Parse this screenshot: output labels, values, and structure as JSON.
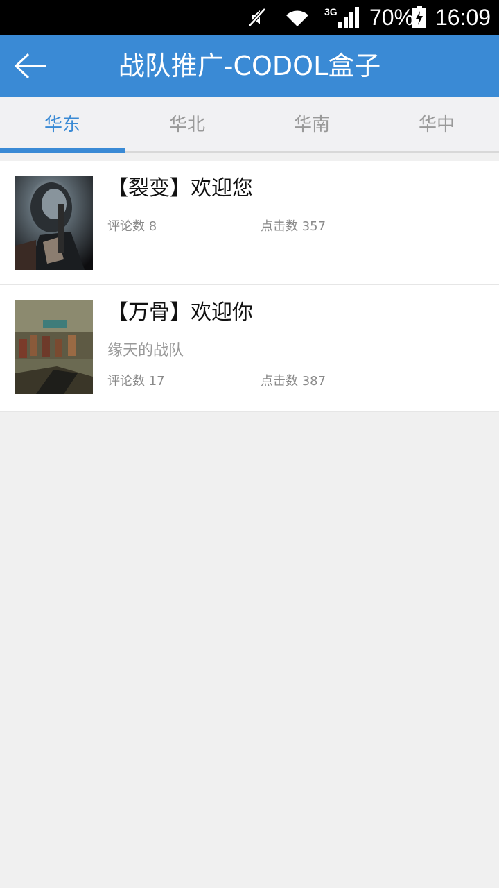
{
  "status_bar": {
    "network": "3G",
    "battery": "70%",
    "time": "16:09",
    "icons": [
      "mute-icon",
      "wifi-icon",
      "signal-icon",
      "battery-charging-icon"
    ]
  },
  "header": {
    "title": "战队推广-CODOL盒子",
    "back_icon": "arrow-left-icon",
    "accent_color": "#3a8ad5"
  },
  "tabs": [
    {
      "label": "华东",
      "active": true
    },
    {
      "label": "华北",
      "active": false
    },
    {
      "label": "华南",
      "active": false
    },
    {
      "label": "华中",
      "active": false
    }
  ],
  "items": [
    {
      "title": "【裂变】欢迎您",
      "subtitle": "",
      "comments": "评论数 8",
      "clicks": "点击数 357"
    },
    {
      "title": "【万骨】欢迎你",
      "subtitle": "缘天的战队",
      "comments": "评论数 17",
      "clicks": "点击数 387"
    }
  ]
}
